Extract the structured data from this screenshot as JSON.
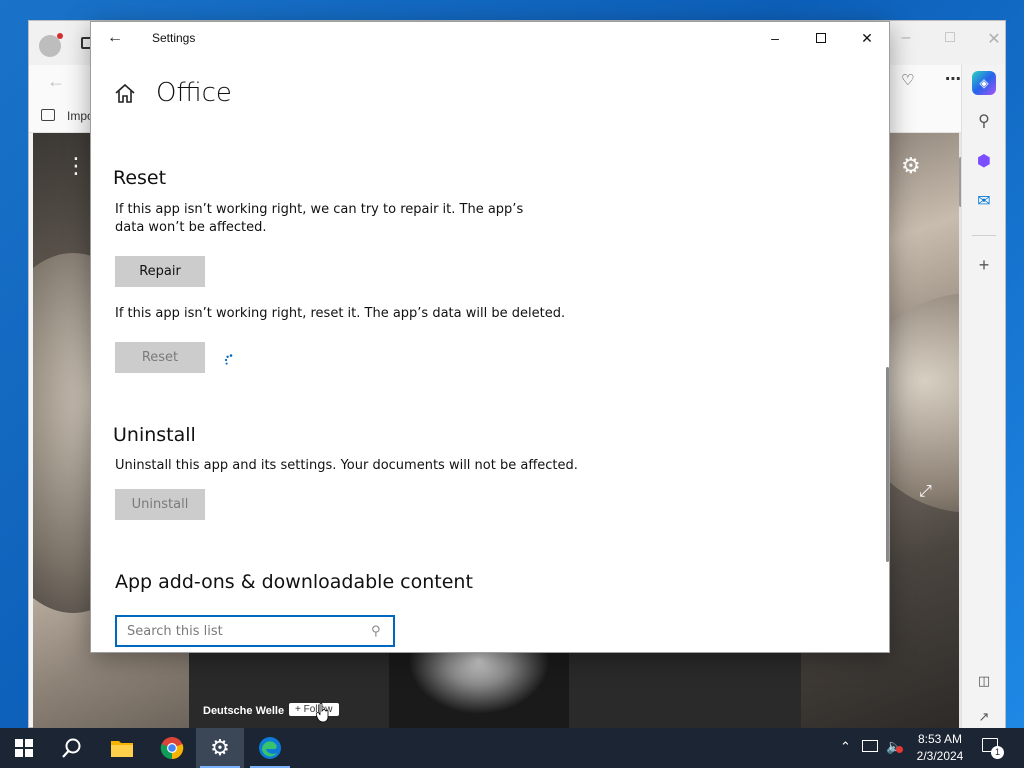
{
  "edge": {
    "fav_label": "Impo",
    "news_source": "Deutsche Welle",
    "news_follow": "+ Follow"
  },
  "settings": {
    "window_title": "Settings",
    "app_title": "Office",
    "reset_section": {
      "title": "Reset",
      "repair_desc": "If this app isn’t working right, we can try to repair it. The app’s data won’t be affected.",
      "repair_button": "Repair",
      "reset_desc": "If this app isn’t working right, reset it. The app’s data will be deleted.",
      "reset_button": "Reset"
    },
    "uninstall_section": {
      "title": "Uninstall",
      "desc": "Uninstall this app and its settings. Your documents will not be affected.",
      "uninstall_button": "Uninstall"
    },
    "addons_section": {
      "title": "App add-ons & downloadable content",
      "search_placeholder": "Search this list"
    }
  },
  "taskbar": {
    "items": [
      "start",
      "search",
      "file-explorer",
      "chrome",
      "settings",
      "edge"
    ],
    "clock_time": "8:53 AM",
    "clock_date": "2/3/2024",
    "notification_count": "1"
  },
  "colors": {
    "accent": "#0067c0",
    "button_bg": "#cccccc",
    "taskbar_bg": "#1c2533"
  }
}
